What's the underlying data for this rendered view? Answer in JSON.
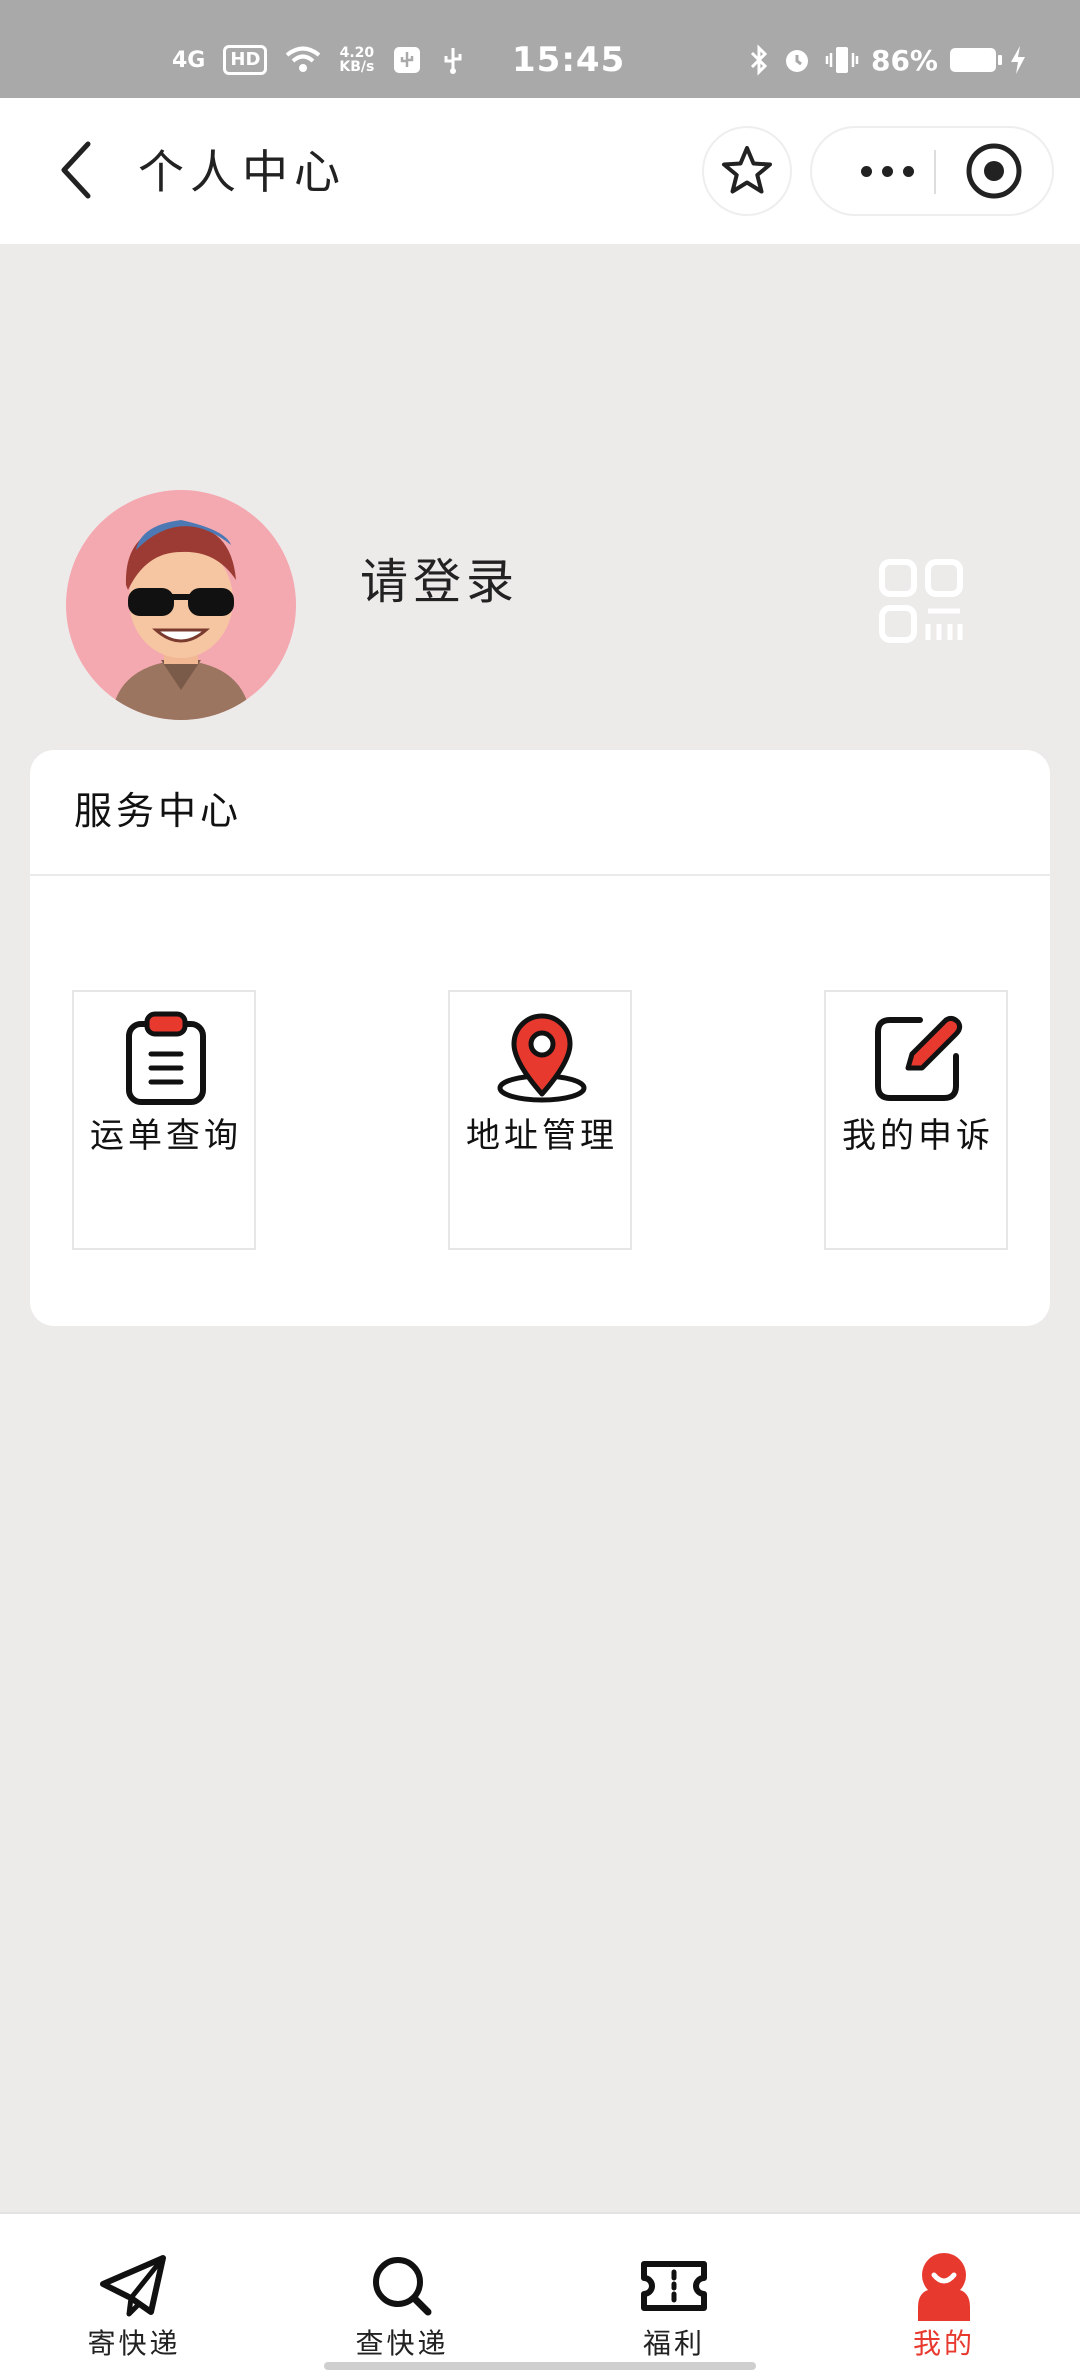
{
  "status_bar": {
    "network": "4G",
    "hd": "HD",
    "speed_value": "4.20",
    "speed_unit": "KB/s",
    "time": "15:45",
    "battery": "86%"
  },
  "header": {
    "title": "个人中心"
  },
  "profile": {
    "login_prompt": "请登录"
  },
  "service_center": {
    "title": "服务中心",
    "items": [
      {
        "label": "运单查询",
        "icon": "clipboard-icon"
      },
      {
        "label": "地址管理",
        "icon": "location-pin-icon"
      },
      {
        "label": "我的申诉",
        "icon": "edit-icon"
      }
    ]
  },
  "bottom_nav": {
    "items": [
      {
        "label": "寄快递",
        "icon": "paper-plane-icon"
      },
      {
        "label": "查快递",
        "icon": "search-icon"
      },
      {
        "label": "福利",
        "icon": "ticket-icon"
      },
      {
        "label": "我的",
        "icon": "profile-icon",
        "active": true
      }
    ]
  },
  "colors": {
    "accent": "#e8392f",
    "page_bg": "#edebea",
    "status_bar_bg": "#a9a9a9",
    "avatar_bg": "#f4a8b0"
  }
}
